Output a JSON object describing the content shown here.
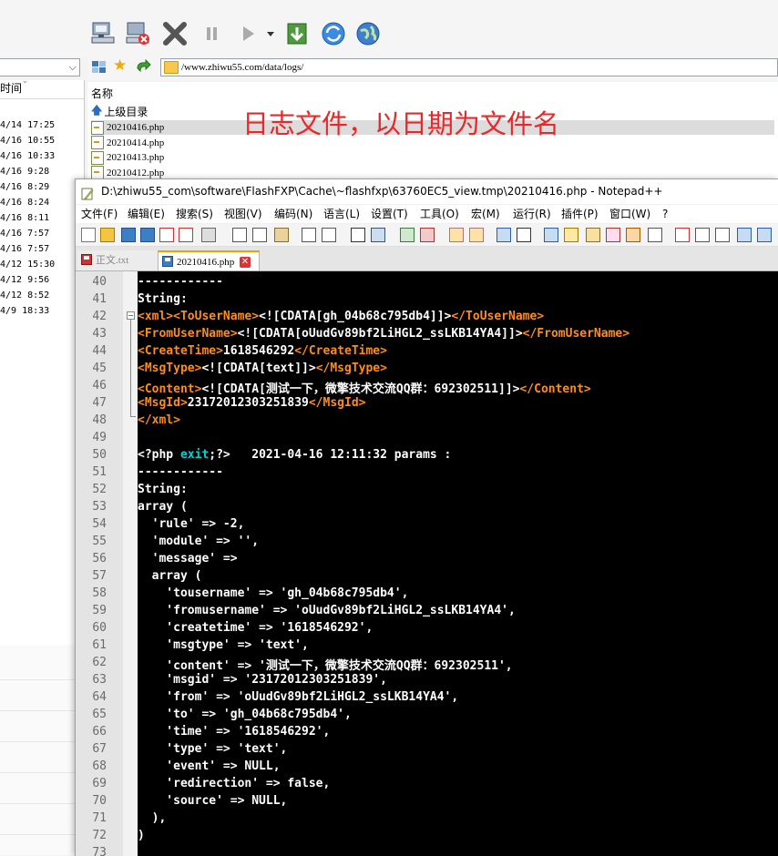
{
  "fxp": {
    "address": "/www.zhiwu55.com/data/logs/",
    "left_header": "时间",
    "left_times": [
      "4/14 17:25",
      "4/16 10:55",
      "4/16 10:33",
      "4/16 9:28",
      "4/16 8:29",
      "4/16 8:24",
      "4/16 8:11",
      "4/16 7:57",
      "4/16 7:57",
      "4/12 15:30",
      "4/12 9:56",
      "4/12 8:52",
      "4/9 18:33"
    ],
    "right_header": "名称",
    "parent_dir": "上级目录",
    "files": [
      "20210416.php",
      "20210414.php",
      "20210413.php",
      "20210412.php"
    ]
  },
  "annotation": "日志文件，以日期为文件名",
  "npp": {
    "title": "D:\\zhiwu55_com\\software\\FlashFXP\\Cache\\~flashfxp\\63760EC5_view.tmp\\20210416.php - Notepad++",
    "menu": [
      "文件(F)",
      "编辑(E)",
      "搜索(S)",
      "视图(V)",
      "编码(N)",
      "语言(L)",
      "设置(T)",
      "工具(O)",
      "宏(M)",
      "运行(R)",
      "插件(P)",
      "窗口(W)",
      "?"
    ],
    "tabs": [
      "正文.txt",
      "20210416.php"
    ],
    "lines": [
      {
        "n": "40",
        "segs": [
          {
            "t": "------------",
            "c": "w"
          }
        ]
      },
      {
        "n": "41",
        "segs": [
          {
            "t": "String:",
            "c": "w"
          }
        ]
      },
      {
        "n": "42",
        "segs": [
          {
            "t": "<xml><ToUserName>",
            "c": "tag"
          },
          {
            "t": "<![CDATA[gh_04b68c795db4]]>",
            "c": "w"
          },
          {
            "t": "</ToUserName>",
            "c": "tag"
          }
        ]
      },
      {
        "n": "43",
        "segs": [
          {
            "t": "<FromUserName>",
            "c": "tag"
          },
          {
            "t": "<![CDATA[oUudGv89bf2LiHGL2_ssLKB14YA4]]>",
            "c": "w"
          },
          {
            "t": "</FromUserName>",
            "c": "tag"
          }
        ]
      },
      {
        "n": "44",
        "segs": [
          {
            "t": "<CreateTime>",
            "c": "tag"
          },
          {
            "t": "1618546292",
            "c": "w"
          },
          {
            "t": "</CreateTime>",
            "c": "tag"
          }
        ]
      },
      {
        "n": "45",
        "segs": [
          {
            "t": "<MsgType>",
            "c": "tag"
          },
          {
            "t": "<![CDATA[text]]>",
            "c": "w"
          },
          {
            "t": "</MsgType>",
            "c": "tag"
          }
        ]
      },
      {
        "n": "46",
        "segs": [
          {
            "t": "<Content>",
            "c": "tag"
          },
          {
            "t": "<![CDATA[测试一下，微擎技术交流QQ群：692302511]]>",
            "c": "w"
          },
          {
            "t": "</Content>",
            "c": "tag"
          }
        ]
      },
      {
        "n": "47",
        "segs": [
          {
            "t": "<MsgId>",
            "c": "tag"
          },
          {
            "t": "23172012303251839",
            "c": "w"
          },
          {
            "t": "</MsgId>",
            "c": "tag"
          }
        ]
      },
      {
        "n": "48",
        "segs": [
          {
            "t": "</xml>",
            "c": "tag"
          }
        ]
      },
      {
        "n": "49",
        "segs": []
      },
      {
        "n": "50",
        "segs": [
          {
            "t": "<?php ",
            "c": "w"
          },
          {
            "t": "exit",
            "c": "kw"
          },
          {
            "t": ";?>   2021-04-16 12:11:32 params :",
            "c": "w"
          }
        ]
      },
      {
        "n": "51",
        "segs": [
          {
            "t": "------------",
            "c": "w"
          }
        ]
      },
      {
        "n": "52",
        "segs": [
          {
            "t": "String:",
            "c": "w"
          }
        ]
      },
      {
        "n": "53",
        "segs": [
          {
            "t": "array (",
            "c": "w"
          }
        ]
      },
      {
        "n": "54",
        "segs": [
          {
            "t": "  'rule' => -2,",
            "c": "w"
          }
        ]
      },
      {
        "n": "55",
        "segs": [
          {
            "t": "  'module' => '',",
            "c": "w"
          }
        ]
      },
      {
        "n": "56",
        "segs": [
          {
            "t": "  'message' =>",
            "c": "w"
          }
        ]
      },
      {
        "n": "57",
        "segs": [
          {
            "t": "  array (",
            "c": "w"
          }
        ]
      },
      {
        "n": "58",
        "segs": [
          {
            "t": "    'tousername' => 'gh_04b68c795db4',",
            "c": "w"
          }
        ]
      },
      {
        "n": "59",
        "segs": [
          {
            "t": "    'fromusername' => 'oUudGv89bf2LiHGL2_ssLKB14YA4',",
            "c": "w"
          }
        ]
      },
      {
        "n": "60",
        "segs": [
          {
            "t": "    'createtime' => '1618546292',",
            "c": "w"
          }
        ]
      },
      {
        "n": "61",
        "segs": [
          {
            "t": "    'msgtype' => 'text',",
            "c": "w"
          }
        ]
      },
      {
        "n": "62",
        "segs": [
          {
            "t": "    'content' => '测试一下，微擎技术交流QQ群：692302511',",
            "c": "w"
          }
        ]
      },
      {
        "n": "63",
        "segs": [
          {
            "t": "    'msgid' => '23172012303251839',",
            "c": "w"
          }
        ]
      },
      {
        "n": "64",
        "segs": [
          {
            "t": "    'from' => 'oUudGv89bf2LiHGL2_ssLKB14YA4',",
            "c": "w"
          }
        ]
      },
      {
        "n": "65",
        "segs": [
          {
            "t": "    'to' => 'gh_04b68c795db4',",
            "c": "w"
          }
        ]
      },
      {
        "n": "66",
        "segs": [
          {
            "t": "    'time' => '1618546292',",
            "c": "w"
          }
        ]
      },
      {
        "n": "67",
        "segs": [
          {
            "t": "    'type' => 'text',",
            "c": "w"
          }
        ]
      },
      {
        "n": "68",
        "segs": [
          {
            "t": "    'event' => NULL,",
            "c": "w"
          }
        ]
      },
      {
        "n": "69",
        "segs": [
          {
            "t": "    'redirection' => false,",
            "c": "w"
          }
        ]
      },
      {
        "n": "70",
        "segs": [
          {
            "t": "    'source' => NULL,",
            "c": "w"
          }
        ]
      },
      {
        "n": "71",
        "segs": [
          {
            "t": "  ),",
            "c": "w"
          }
        ]
      },
      {
        "n": "72",
        "segs": [
          {
            "t": ")",
            "c": "w"
          }
        ]
      },
      {
        "n": "73",
        "segs": []
      }
    ]
  }
}
